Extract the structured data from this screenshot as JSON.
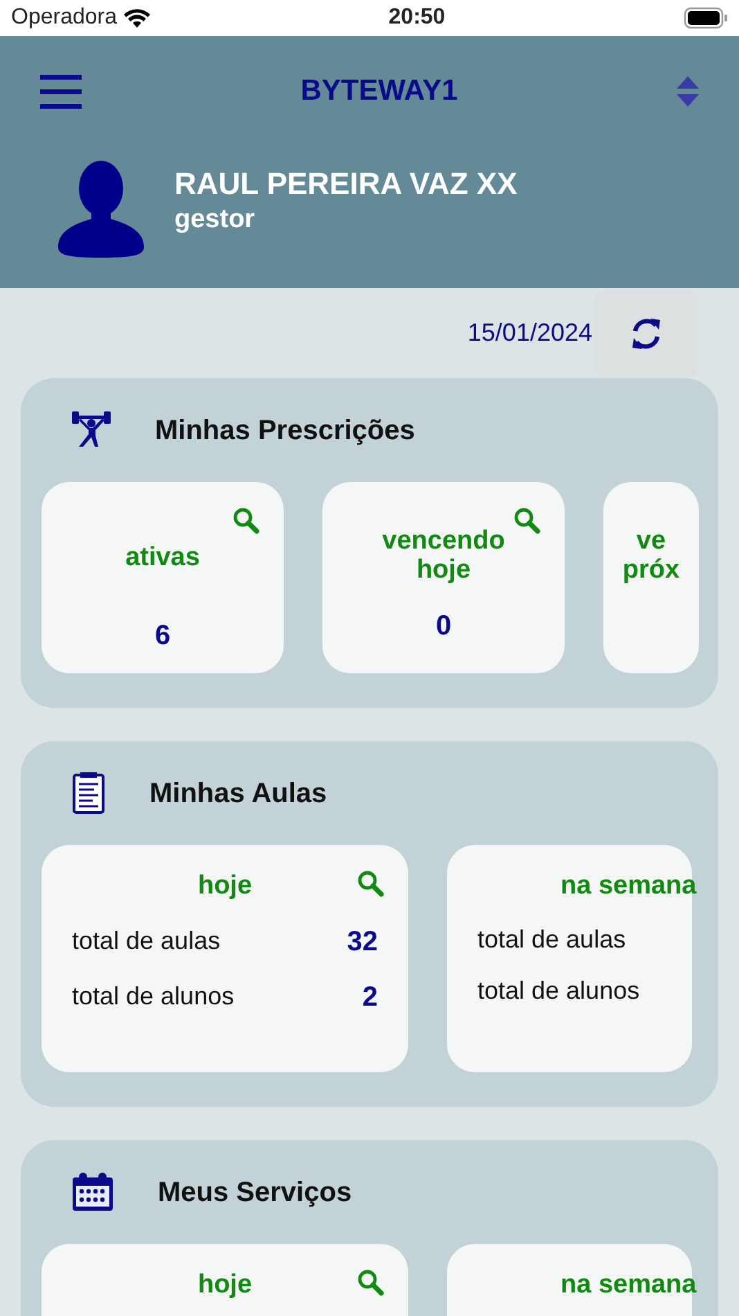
{
  "status_bar": {
    "carrier": "Operadora",
    "time": "20:50"
  },
  "header": {
    "title": "BYTEWAY1",
    "user_name": "RAUL PEREIRA VAZ XX",
    "role": "gestor"
  },
  "date": "15/01/2024",
  "sections": [
    {
      "title": "Minhas Prescrições",
      "cards": [
        {
          "kind": "count",
          "lines": [
            "ativas"
          ],
          "value": "6"
        },
        {
          "kind": "count",
          "lines": [
            "vencendo",
            "hoje"
          ],
          "value": "0"
        },
        {
          "kind": "partial_count",
          "lines": [
            "ve",
            "próx"
          ]
        }
      ]
    },
    {
      "title": "Minhas Aulas",
      "cards": [
        {
          "kind": "stats",
          "title": "hoje",
          "rows": [
            {
              "label": "total de aulas",
              "value": "32"
            },
            {
              "label": "total de alunos",
              "value": "2"
            }
          ]
        },
        {
          "kind": "partial_stats",
          "title": "na semana",
          "rows": [
            {
              "label": "total de aulas"
            },
            {
              "label": "total de alunos"
            }
          ]
        }
      ]
    },
    {
      "title": "Meus Serviços",
      "cards": [
        {
          "kind": "stats",
          "title": "hoje"
        },
        {
          "kind": "partial_stats",
          "title": "na semana"
        }
      ]
    }
  ]
}
